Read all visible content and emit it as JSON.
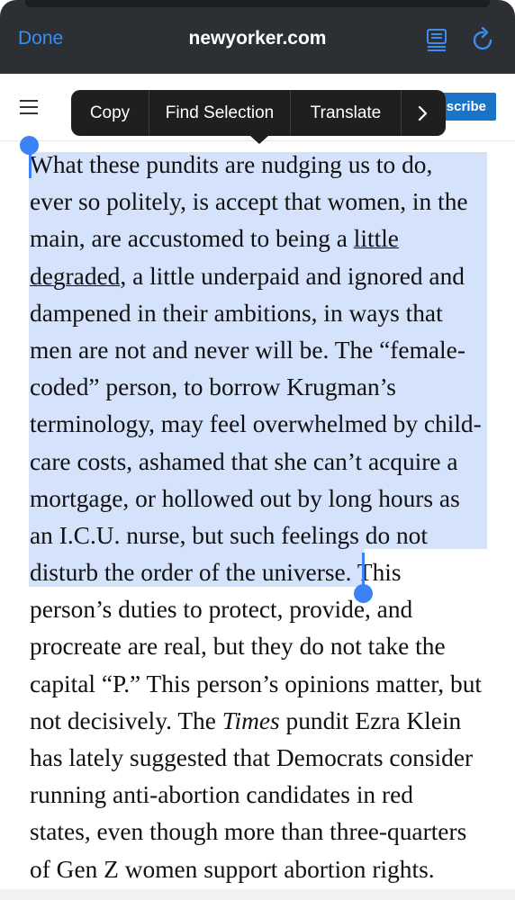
{
  "browser": {
    "done_label": "Done",
    "url": "newyorker.com",
    "reader_icon": "reader-view-icon",
    "reload_icon": "reload-icon",
    "accent_color": "#3b8ef0"
  },
  "site_header": {
    "menu_icon": "hamburger-menu-icon",
    "subscribe_label": "scribe"
  },
  "context_menu": {
    "items": [
      "Copy",
      "Find Selection",
      "Translate"
    ],
    "more_icon": "chevron-right-icon"
  },
  "article": {
    "lines": [
      "What these pundits are nudging us to do,",
      "ever so politely, is accept that women, in the",
      "main, are accustomed to being a ",
      "little",
      "degraded",
      ", a little underpaid and ignored and",
      "dampened in their ambitions, in ways that",
      "men are not and never will be. The “female-",
      "coded” person, to borrow Krugman’s",
      "terminology, may feel overwhelmed by child-",
      "care costs, ashamed that she can’t acquire a",
      "mortgage, or hollowed out by long hours as",
      "an I.C.U. nurse, but such feelings do not",
      "disturb the order of the universe. ",
      "This",
      "person’s duties to protect, provide, and",
      "procreate are real, but they do not take the",
      "capital “P.” This person’s opinions matter, but",
      "not decisively. The ",
      "Times",
      " pundit Ezra Klein",
      "has lately suggested that Democrats consider",
      "running anti-abortion candidates in red",
      "states, even though more than three-quarters",
      "of Gen Z women support abortion rights."
    ],
    "selection_color": "#d4e3fb",
    "handle_color": "#3b82f6"
  }
}
